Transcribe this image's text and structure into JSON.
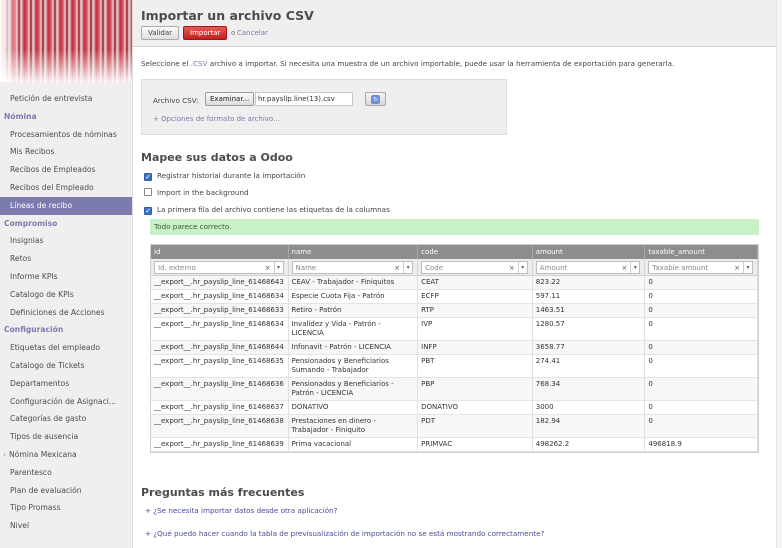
{
  "sidebar": {
    "items": [
      {
        "label": "Petición de entrevista",
        "kind": "item"
      },
      {
        "label": "Nómina",
        "kind": "section"
      },
      {
        "label": "Procesamientos de nóminas",
        "kind": "item"
      },
      {
        "label": "Mis Recibos",
        "kind": "item"
      },
      {
        "label": "Recibos de Empleados",
        "kind": "item"
      },
      {
        "label": "Recibos del Empleado",
        "kind": "item"
      },
      {
        "label": "Líneas de recibo",
        "kind": "active"
      },
      {
        "label": "Compromiso",
        "kind": "section"
      },
      {
        "label": "Insignias",
        "kind": "item"
      },
      {
        "label": "Retos",
        "kind": "item"
      },
      {
        "label": "Informe KPIs",
        "kind": "item"
      },
      {
        "label": "Catalogo de KPIs",
        "kind": "item"
      },
      {
        "label": "Definiciones de Acciones",
        "kind": "item"
      },
      {
        "label": "Configuración",
        "kind": "section"
      },
      {
        "label": "Etiquetas del empleado",
        "kind": "item"
      },
      {
        "label": "Catalogo de Tickets",
        "kind": "item"
      },
      {
        "label": "Departamentos",
        "kind": "item"
      },
      {
        "label": "Configuración de Asignaci...",
        "kind": "item"
      },
      {
        "label": "Categorías de gasto",
        "kind": "item"
      },
      {
        "label": "Tipos de ausencia",
        "kind": "item"
      },
      {
        "label": "Nómina Mexicana",
        "kind": "caret"
      },
      {
        "label": "Parentesco",
        "kind": "item"
      },
      {
        "label": "Plan de evaluación",
        "kind": "item"
      },
      {
        "label": "Tipo Promass",
        "kind": "item"
      },
      {
        "label": "Nivel",
        "kind": "item"
      }
    ]
  },
  "header": {
    "title": "Importar un archivo CSV",
    "validate_label": "Validar",
    "import_label": "Importar",
    "or_label": "o",
    "cancel_label": "Cancelar"
  },
  "intro": {
    "before": "Seleccione el",
    "csv": ".CSV",
    "after": "archivo a importar. Si necesita una muestra de un archivo importable, puede usar la herramienta de exportación para generarla."
  },
  "file": {
    "label": "Archivo CSV:",
    "browse_label": "Examinar...",
    "file_name": "hr.payslip.line(13).csv",
    "format_options_link": "+ Opciones de formato de archivo..."
  },
  "mapping": {
    "title": "Mapee sus datos a Odoo",
    "options": [
      {
        "label": "Registrar historial durante la importación",
        "checked": true
      },
      {
        "label": "Import in the background",
        "checked": false
      },
      {
        "label": "La primera fila del archivo contiene las etiquetas de la columnas",
        "checked": true
      }
    ],
    "status": "Todo parece correcto."
  },
  "preview": {
    "columns": [
      {
        "header": "id",
        "field": "Id. externo"
      },
      {
        "header": "name",
        "field": "Name"
      },
      {
        "header": "code",
        "field": "Code"
      },
      {
        "header": "amount",
        "field": "Amount"
      },
      {
        "header": "taxable_amount",
        "field": "Taxable amount"
      }
    ],
    "rows": [
      [
        "__export__.hr_payslip_line_61468643",
        "CEAV - Trabajador - Finiquitos",
        "CEAT",
        "823.22",
        "0"
      ],
      [
        "__export__.hr_payslip_line_61468634",
        "Especie Cuota Fija - Patrón",
        "ECFP",
        "597.11",
        "0"
      ],
      [
        "__export__.hr_payslip_line_61468633",
        "Retiro - Patrón",
        "RTP",
        "1463.51",
        "0"
      ],
      [
        "__export__.hr_payslip_line_61468634",
        "Invalidez y Vida - Patrón - LICENCIA",
        "IVP",
        "1280.57",
        "0"
      ],
      [
        "__export__.hr_payslip_line_61468644",
        "Infonavit - Patrón - LICENCIA",
        "INFP",
        "3658.77",
        "0"
      ],
      [
        "__export__.hr_payslip_line_61468635",
        "Pensionados y Beneficiarios Sumando - Trabajador",
        "PBT",
        "274.41",
        "0"
      ],
      [
        "__export__.hr_payslip_line_61468636",
        "Pensionados y Beneficiarios - Patrón - LICENCIA",
        "PBP",
        "768.34",
        "0"
      ],
      [
        "__export__.hr_payslip_line_61468637",
        "DONATIVO",
        "DONATIVO",
        "3000",
        "0"
      ],
      [
        "__export__.hr_payslip_line_61468638",
        "Prestaciones en dinero - Trabajador - Finiquito",
        "PDT",
        "182.94",
        "0"
      ],
      [
        "__export__.hr_payslip_line_61468639",
        "Prima vacacional",
        "PRIMVAC",
        "498262.2",
        "496818.9"
      ]
    ]
  },
  "faq": {
    "title": "Preguntas más frecuentes",
    "items": [
      "+ ¿Se necesita importar datos desde otra aplicación?",
      "+ ¿Qué puedo hacer cuando la tabla de previsualización de importación no se está mostrando correctamente?"
    ]
  }
}
